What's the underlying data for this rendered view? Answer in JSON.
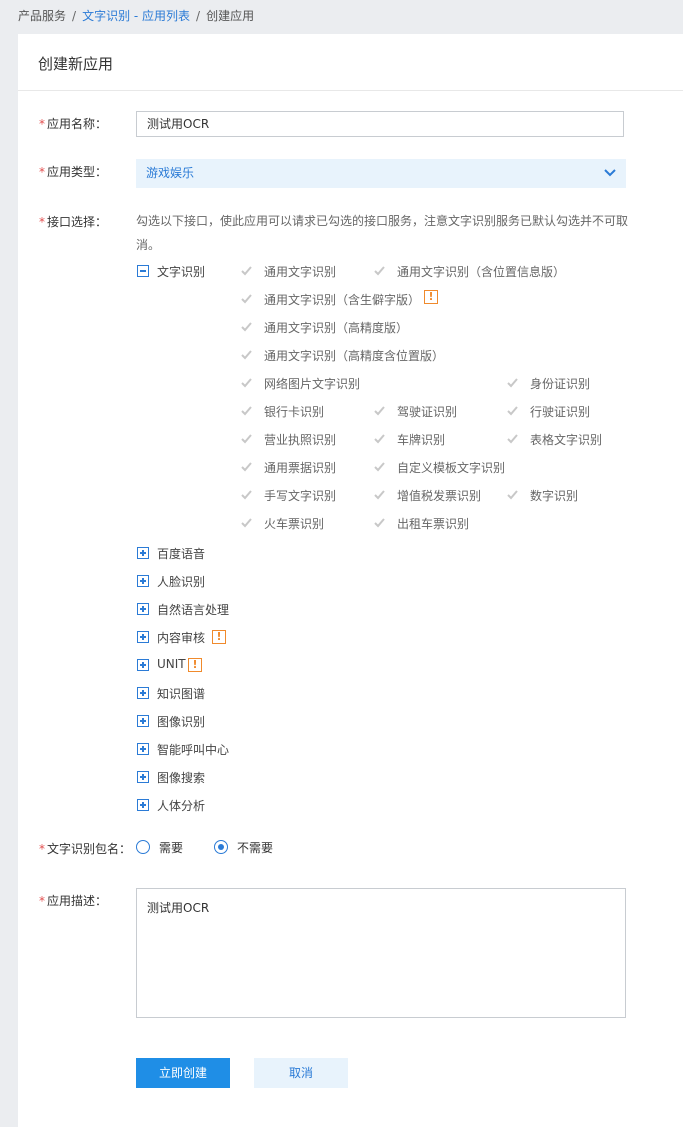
{
  "breadcrumb": {
    "root": "产品服务",
    "parent": "文字识别 - 应用列表",
    "current": "创建应用"
  },
  "panel": {
    "title": "创建新应用"
  },
  "form": {
    "name": {
      "label": "应用名称：",
      "value": "测试用OCR"
    },
    "type": {
      "label": "应用类型：",
      "value": "游戏娱乐"
    },
    "api": {
      "label": "接口选择：",
      "hint": "勾选以下接口，使此应用可以请求已勾选的接口服务，注意文字识别服务已默认勾选并不可取消。",
      "expanded_group": {
        "label": "文字识别",
        "items": [
          "通用文字识别",
          "通用文字识别（含位置信息版）",
          "通用文字识别（含生僻字版）",
          "通用文字识别（高精度版）",
          "通用文字识别（高精度含位置版）",
          "网络图片文字识别",
          "身份证识别",
          "银行卡识别",
          "驾驶证识别",
          "行驶证识别",
          "营业执照识别",
          "车牌识别",
          "表格文字识别",
          "通用票据识别",
          "自定义模板文字识别",
          "手写文字识别",
          "增值税发票识别",
          "数字识别",
          "火车票识别",
          "出租车票识别"
        ]
      },
      "groups": [
        "百度语音",
        "人脸识别",
        "自然语言处理",
        "内容审核",
        "UNIT",
        "知识图谱",
        "图像识别",
        "智能呼叫中心",
        "图像搜索",
        "人体分析"
      ],
      "warn_mark": "!"
    },
    "package": {
      "label": "文字识别包名：",
      "options": [
        "需要",
        "不需要"
      ],
      "selected": "不需要"
    },
    "description": {
      "label": "应用描述：",
      "value": "测试用OCR"
    },
    "submit": "立即创建",
    "cancel": "取消"
  },
  "colors": {
    "accent": "#2b7bd6",
    "primary_button": "#1f8ee6",
    "warning": "#f08a2c",
    "required": "#e24e4e"
  }
}
